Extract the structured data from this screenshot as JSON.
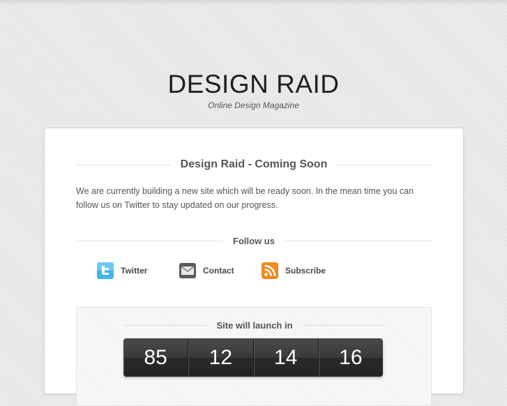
{
  "site": {
    "title": "DESIGN RAID",
    "tagline": "Online Design Magazine"
  },
  "main": {
    "heading": "Design Raid - Coming Soon",
    "intro": "We are currently building a new site which will be ready soon. In the mean time you can follow us on Twitter to stay updated on our progress."
  },
  "follow": {
    "heading": "Follow us",
    "links": [
      {
        "label": "Twitter",
        "icon": "twitter-icon"
      },
      {
        "label": "Contact",
        "icon": "mail-icon"
      },
      {
        "label": "Subscribe",
        "icon": "rss-icon"
      }
    ]
  },
  "countdown": {
    "heading": "Site will launch in",
    "values": [
      "85",
      "12",
      "14",
      "16"
    ]
  },
  "colors": {
    "background": "#e6e6e6",
    "card": "#ffffff",
    "text": "#555555",
    "twitter": "#3fb6ea",
    "rss": "#f28a1c",
    "counter": "#2f2f2f"
  }
}
